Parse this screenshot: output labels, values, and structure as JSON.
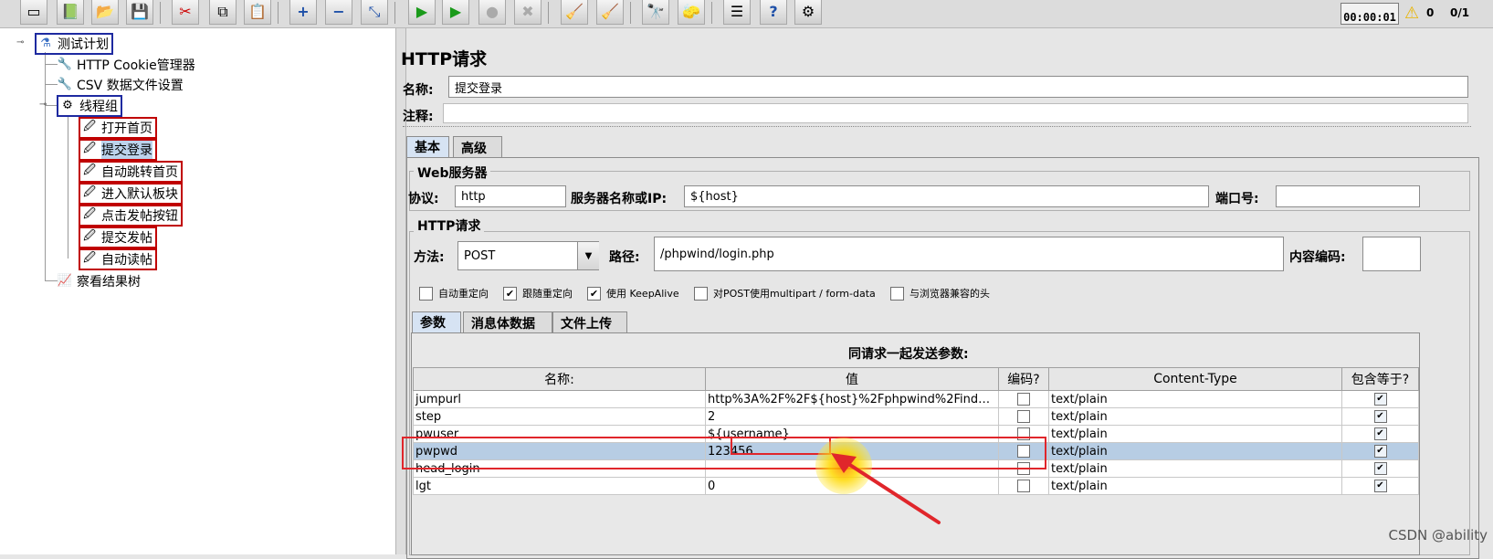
{
  "toolbar": {
    "icons": [
      "new-icon",
      "templates-icon",
      "open-icon",
      "save-icon",
      "cut-icon",
      "copy-icon",
      "paste-icon",
      "expand-icon",
      "collapse-icon",
      "toggle-icon",
      "start-icon",
      "start-no-pause-icon",
      "stop-icon",
      "shutdown-icon",
      "clear-icon",
      "clear-all-icon",
      "search-icon",
      "reset-search-icon",
      "function-helper-icon",
      "help-icon",
      "remote-icon"
    ],
    "timer": "00:00:01",
    "warnings": "0",
    "threads": "0/1"
  },
  "tree": {
    "root": "测试计划",
    "cookie_manager": "HTTP Cookie管理器",
    "csv_config": "CSV 数据文件设置",
    "thread_group": "线程组",
    "samplers": [
      "打开首页",
      "提交登录",
      "自动跳转首页",
      "进入默认板块",
      "点击发帖按钮",
      "提交发帖",
      "自动读帖"
    ],
    "listener": "察看结果树"
  },
  "panel": {
    "title": "HTTP请求",
    "name_label": "名称:",
    "name_value": "提交登录",
    "comment_label": "注释:",
    "comment_value": "",
    "tabs": [
      "基本",
      "高级"
    ],
    "web_server": {
      "title": "Web服务器",
      "protocol_label": "协议:",
      "protocol_value": "http",
      "server_label": "服务器名称或IP:",
      "server_value": "${host}",
      "port_label": "端口号:",
      "port_value": ""
    },
    "http_request": {
      "title": "HTTP请求",
      "method_label": "方法:",
      "method_value": "POST",
      "path_label": "路径:",
      "path_value": "/phpwind/login.php",
      "encoding_label": "内容编码:",
      "encoding_value": ""
    },
    "options": [
      {
        "label": "自动重定向",
        "checked": false
      },
      {
        "label": "跟随重定向",
        "checked": true
      },
      {
        "label": "使用 KeepAlive",
        "checked": true
      },
      {
        "label": "对POST使用multipart / form-data",
        "checked": false
      },
      {
        "label": "与浏览器兼容的头",
        "checked": false
      }
    ],
    "sub_tabs": [
      "参数",
      "消息体数据",
      "文件上传"
    ],
    "params_title": "同请求一起发送参数:",
    "columns": [
      "名称:",
      "值",
      "编码?",
      "Content-Type",
      "包含等于?"
    ],
    "rows": [
      {
        "name": "jumpurl",
        "value": "http%3A%2F%2F${host}%2Fphpwind%2Findex...",
        "encode": false,
        "content_type": "text/plain",
        "include_equals": true
      },
      {
        "name": "step",
        "value": "2",
        "encode": false,
        "content_type": "text/plain",
        "include_equals": true
      },
      {
        "name": "pwuser",
        "value": "${username}",
        "encode": false,
        "content_type": "text/plain",
        "include_equals": true
      },
      {
        "name": "pwpwd",
        "value": "123456",
        "encode": false,
        "content_type": "text/plain",
        "include_equals": true
      },
      {
        "name": "head_login",
        "value": "",
        "encode": false,
        "content_type": "text/plain",
        "include_equals": true
      },
      {
        "name": "lgt",
        "value": "0",
        "encode": false,
        "content_type": "text/plain",
        "include_equals": true
      }
    ]
  },
  "watermark": "CSDN @ability",
  "colors": {
    "annotation_red": "#e0262b",
    "selection_blue": "#b7cde4",
    "cursor_yellow": "#ffd800"
  }
}
